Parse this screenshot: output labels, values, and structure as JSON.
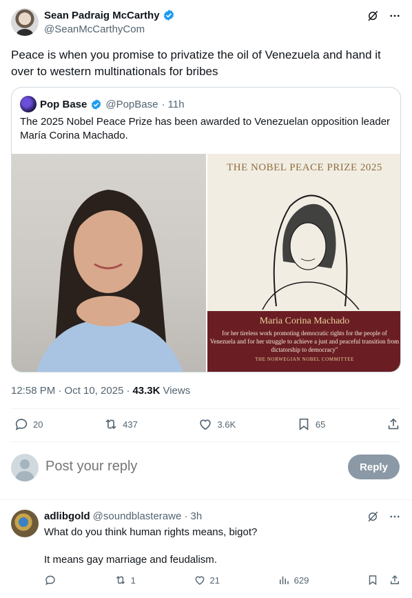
{
  "post": {
    "author_name": "Sean Padraig McCarthy",
    "author_handle": "@SeanMcCarthyCom",
    "text": "Peace is when you promise to privatize the oil of Venezuela and hand it over to western multinationals for bribes",
    "timestamp": "12:58 PM · Oct 10, 2025",
    "views_count": "43.3K",
    "views_label": "Views",
    "stats": {
      "replies": "20",
      "reposts": "437",
      "likes": "3.6K",
      "bookmarks": "65"
    }
  },
  "quote": {
    "author_name": "Pop Base",
    "author_handle": "@PopBase",
    "time": "· 11h",
    "text": "The 2025 Nobel Peace Prize has been awarded to Venezuelan opposition leader María Corina Machado.",
    "poster": {
      "title": "THE NOBEL PEACE PRIZE 2025",
      "name": "Maria Corina Machado",
      "citation": "for her tireless work promoting democratic rights for the people of Venezuela and for her struggle to achieve a just and peaceful transition from dictatorship to democracy\"",
      "committee": "THE NORWEGIAN NOBEL COMMITTEE"
    }
  },
  "compose": {
    "placeholder": "Post your reply",
    "button_label": "Reply"
  },
  "reply": {
    "author_name": "adlibgold",
    "author_handle": "@soundblasterawe",
    "time": "· 3h",
    "line1": "What do you think human rights means, bigot?",
    "line2": "It means gay marriage and feudalism.",
    "stats": {
      "replies": "",
      "reposts": "1",
      "likes": "21",
      "views": "629"
    }
  },
  "colors": {
    "verified": "#1d9bf0",
    "muted": "#536471",
    "reply_button": "#8b98a5",
    "poster_band": "#6a1e24"
  },
  "icons": [
    "verified-badge-icon",
    "grok-icon",
    "more-icon",
    "reply-icon",
    "repost-icon",
    "like-icon",
    "bookmark-icon",
    "share-icon",
    "views-icon"
  ]
}
